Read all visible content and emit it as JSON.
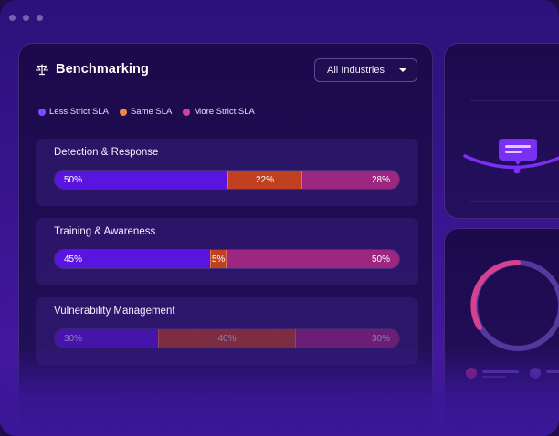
{
  "window": {
    "dots": [
      "dot",
      "dot",
      "dot"
    ]
  },
  "card": {
    "title": "Benchmarking",
    "icon": "scale-icon",
    "dropdown": {
      "selected": "All Industries",
      "icon": "chevron-down-icon"
    }
  },
  "legend": [
    {
      "label": "Less Strict SLA",
      "color": "#7b4dff"
    },
    {
      "label": "Same SLA",
      "color": "#f08a3c"
    },
    {
      "label": "More Strict SLA",
      "color": "#d9409a"
    }
  ],
  "rows": [
    {
      "label": "Detection & Response",
      "less": 50,
      "same": 22,
      "more": 28,
      "less_text": "50%",
      "same_text": "22%",
      "more_text": "28%"
    },
    {
      "label": "Training & Awareness",
      "less": 45,
      "same": 5,
      "more": 50,
      "less_text": "45%",
      "same_text": "5%",
      "more_text": "50%"
    },
    {
      "label": "Vulnerability Management",
      "less": 30,
      "same": 40,
      "more": 30,
      "less_text": "30%",
      "same_text": "40%",
      "more_text": "30%"
    }
  ],
  "colors": {
    "less": "#5a14e0",
    "same": "#c0401f",
    "more": "#9d2680",
    "accent": "#7b2ff0",
    "donut": "#d6418f"
  }
}
